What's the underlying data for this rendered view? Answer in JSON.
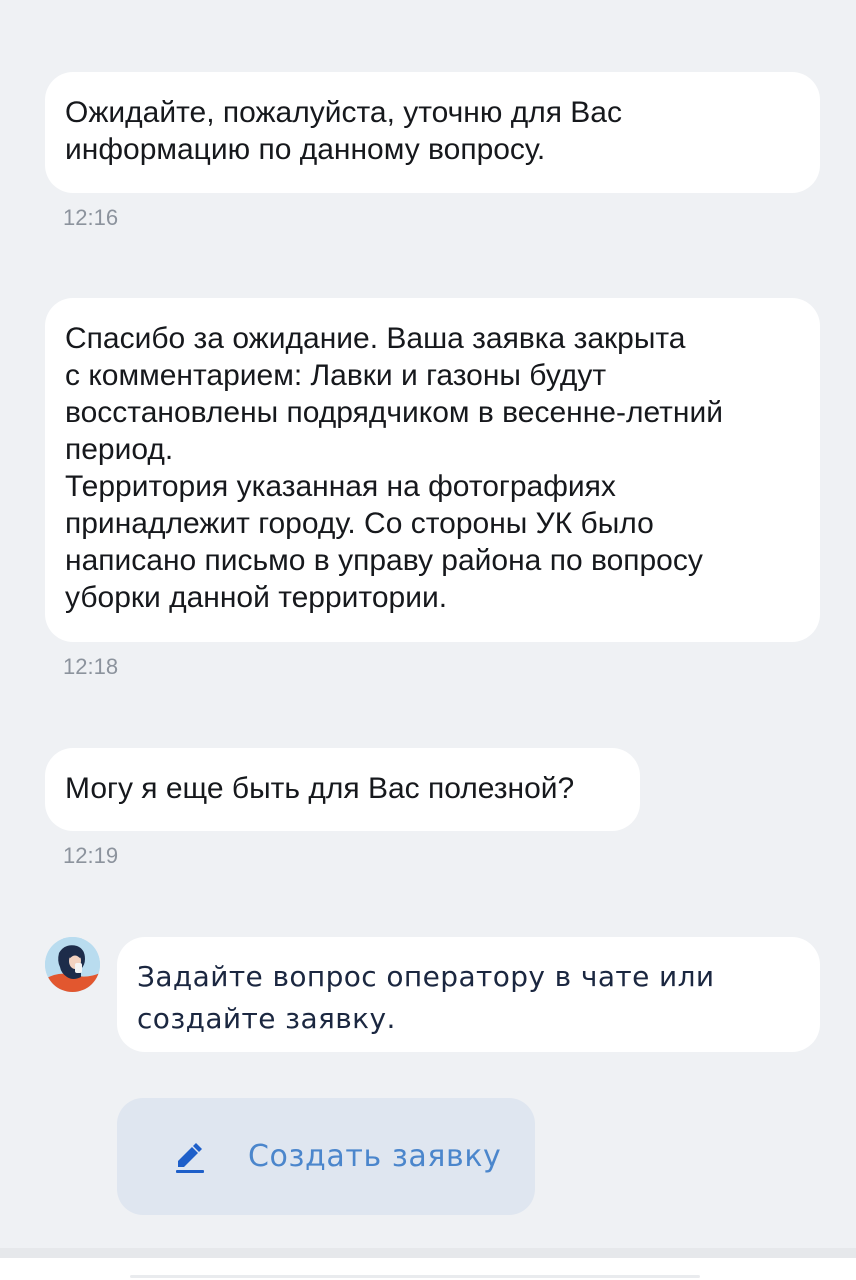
{
  "messages": [
    {
      "text": "Ожидайте, пожалуйста, уточню для Вас\nинформацию по данному вопросу.",
      "time": "12:16"
    },
    {
      "text": "Спасибо за ожидание. Ваша заявка закрыта\nс комментарием: Лавки и газоны будут\nвосстановлены подрядчиком в весенне-летний\nпериод.\nТерритория указанная на фотографиях\nпринадлежит городу. Со стороны УК было\nнаписано письмо в управу района по вопросу\nуборки данной территории.",
      "time": "12:18"
    },
    {
      "text": "Могу я еще быть для Вас полезной?",
      "time": "12:19"
    }
  ],
  "bot": {
    "text": "Задайте вопрос оператору в чате или\nсоздайте заявку."
  },
  "actions": {
    "create_request_label": "Создать заявку",
    "create_request_icon": "edit-pen-icon"
  },
  "colors": {
    "background": "#eff1f4",
    "bubble": "#ffffff",
    "accent": "#4b86cc",
    "button_bg": "#dfe6f0"
  }
}
